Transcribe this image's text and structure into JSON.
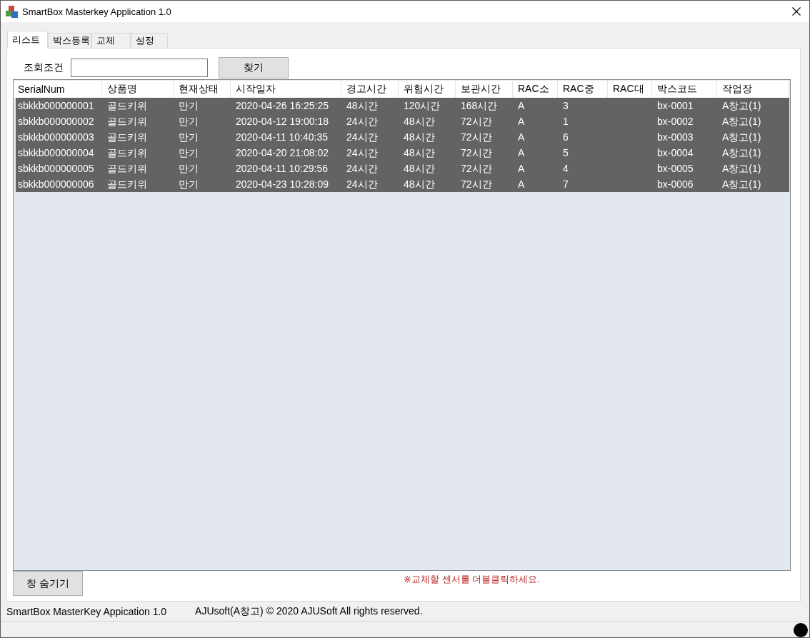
{
  "window": {
    "title": "SmartBox Masterkey Application 1.0"
  },
  "tabs": [
    {
      "label": "리스트",
      "selected": true
    },
    {
      "label": "박스등록",
      "selected": false
    },
    {
      "label": "교체",
      "selected": false
    },
    {
      "label": "설정",
      "selected": false
    }
  ],
  "search": {
    "label": "조회조건",
    "button": "찾기"
  },
  "table": {
    "columns": [
      "SerialNum",
      "상품명",
      "현재상태",
      "시작일자",
      "경고시간",
      "위험시간",
      "보관시간",
      "RAC소",
      "RAC중",
      "RAC대",
      "박스코드",
      "작업장"
    ],
    "rows": [
      {
        "selected": true,
        "cells": [
          "sbkkb000000001",
          "골드키위",
          "만기",
          "2020-04-26 16:25:25",
          "48시간",
          "120시간",
          "168시간",
          "A",
          "3",
          null,
          "bx-0001",
          "A창고(1)"
        ]
      },
      {
        "selected": true,
        "cells": [
          "sbkkb000000002",
          "골드키위",
          "만기",
          "2020-04-12 19:00:18",
          "24시간",
          "48시간",
          "72시간",
          "A",
          "1",
          null,
          "bx-0002",
          "A창고(1)"
        ]
      },
      {
        "selected": true,
        "cells": [
          "sbkkb000000003",
          "골드키위",
          "만기",
          "2020-04-11 10:40:35",
          "24시간",
          "48시간",
          "72시간",
          "A",
          "6",
          null,
          "bx-0003",
          "A창고(1)"
        ]
      },
      {
        "selected": true,
        "cells": [
          "sbkkb000000004",
          "골드키위",
          "만기",
          "2020-04-20 21:08:02",
          "24시간",
          "48시간",
          "72시간",
          "A",
          "5",
          null,
          "bx-0004",
          "A창고(1)"
        ]
      },
      {
        "selected": true,
        "cells": [
          "sbkkb000000005",
          "골드키위",
          "만기",
          "2020-04-11 10:29:56",
          "24시간",
          "48시간",
          "72시간",
          "A",
          "4",
          null,
          "bx-0005",
          "A창고(1)"
        ]
      },
      {
        "selected": true,
        "cells": [
          "sbkkb000000006",
          "골드키위",
          "만기",
          "2020-04-23 10:28:09",
          "24시간",
          "48시간",
          "72시간",
          "A",
          "7",
          null,
          "bx-0006",
          "A창고(1)"
        ]
      }
    ]
  },
  "hide_button": "창 숨기기",
  "hint": "※교체할 센서를 더블클릭하세요.",
  "status_bar": [
    "SmartBox MasterKey Appication 1.0",
    "AJUsoft(A창고) © 2020 AJUSoft All rights reserved."
  ]
}
